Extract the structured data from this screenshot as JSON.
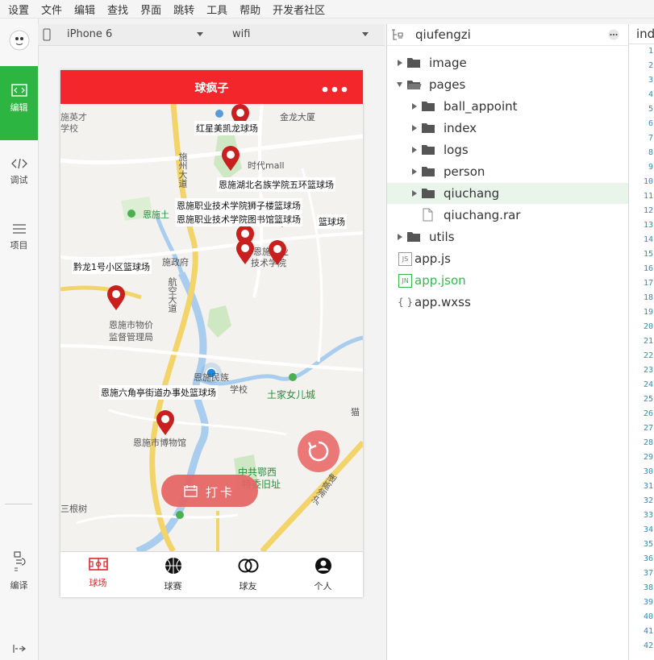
{
  "menu": [
    "设置",
    "文件",
    "编辑",
    "查找",
    "界面",
    "跳转",
    "工具",
    "帮助",
    "开发者社区"
  ],
  "activity": {
    "edit": "编辑",
    "debug": "调试",
    "project": "项目",
    "compile": "编译"
  },
  "simulator": {
    "device": "iPhone 6",
    "network": "wifi"
  },
  "app": {
    "title": "球疯子",
    "checkin_label": "打卡",
    "map_labels": [
      "红星美凯龙球场",
      "恩施湖北名族学院五环篮球场",
      "恩施职业技术学院狮子楼篮球场",
      "恩施职业技术学院图书馆篮球场",
      "篮球场",
      "黔龙1号小区篮球场",
      "恩施六角亭街道办事处篮球场"
    ],
    "map_places": [
      "金龙大厦",
      "时代mall",
      "恩施土",
      "施州大道",
      "施政府",
      "航空大道",
      "恩施市物价",
      "监督管理局",
      "恩施职业",
      "技术学院",
      "恩施民族",
      "学校",
      "土家女儿城",
      "恩施市博物馆",
      "中共鄂西",
      "特委旧址",
      "沪渝高速",
      "三根树",
      "猫",
      "施英才",
      "学校"
    ],
    "tabs": [
      "球场",
      "球赛",
      "球友",
      "个人"
    ]
  },
  "explorer": {
    "root": "qiufengzi",
    "items": [
      {
        "name": "image",
        "kind": "folder",
        "depth": 0,
        "expanded": false
      },
      {
        "name": "pages",
        "kind": "folder",
        "depth": 0,
        "expanded": true
      },
      {
        "name": "ball_appoint",
        "kind": "folder",
        "depth": 1,
        "expanded": false
      },
      {
        "name": "index",
        "kind": "folder",
        "depth": 1,
        "expanded": false
      },
      {
        "name": "logs",
        "kind": "folder",
        "depth": 1,
        "expanded": false
      },
      {
        "name": "person",
        "kind": "folder",
        "depth": 1,
        "expanded": false
      },
      {
        "name": "qiuchang",
        "kind": "folder",
        "depth": 1,
        "expanded": false,
        "selected": true
      },
      {
        "name": "qiuchang.rar",
        "kind": "file",
        "depth": 1
      },
      {
        "name": "utils",
        "kind": "folder",
        "depth": 0,
        "expanded": false
      },
      {
        "name": "app.js",
        "kind": "js",
        "depth": 0
      },
      {
        "name": "app.json",
        "kind": "json",
        "depth": 0
      },
      {
        "name": "app.wxss",
        "kind": "wxss",
        "depth": 0
      }
    ]
  },
  "editor": {
    "tab_label": "ind",
    "line_numbers": [
      "1",
      "2",
      "3",
      "4",
      "5",
      "6",
      "7",
      "8",
      "9",
      "10",
      "11",
      "12",
      "13",
      "14",
      "15",
      "16",
      "17",
      "18",
      "19",
      "20",
      "21",
      "22",
      "23",
      "24",
      "25",
      "26",
      "27",
      "28",
      "29",
      "30",
      "31",
      "32",
      "33",
      "34",
      "35",
      "36",
      "37",
      "38",
      "39",
      "40",
      "41",
      "42"
    ]
  },
  "colors": {
    "brand_red": "#f3262b",
    "active_green": "#2db542",
    "json_green": "#3ab54a",
    "line_number_blue": "#2a8fb5"
  }
}
